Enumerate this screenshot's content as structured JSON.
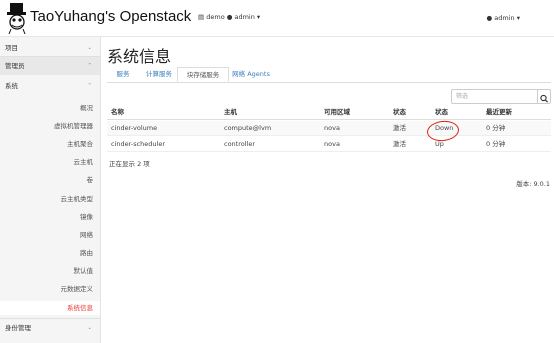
{
  "header": {
    "brand": "TaoYuhang's Openstack",
    "project_label": "demo ● admin ▾",
    "user_label": "admin ▾"
  },
  "sidebar": {
    "sections": [
      {
        "label": "项目",
        "chevron": "⌄"
      },
      {
        "label": "管理员",
        "chevron": "⌃"
      },
      {
        "label": "系统",
        "chevron": "⌃"
      }
    ],
    "items": [
      {
        "label": "概况"
      },
      {
        "label": "虚拟机管理器"
      },
      {
        "label": "主机聚合"
      },
      {
        "label": "云主机"
      },
      {
        "label": "卷"
      },
      {
        "label": "云主机类型"
      },
      {
        "label": "镜像"
      },
      {
        "label": "网络"
      },
      {
        "label": "路由"
      },
      {
        "label": "默认值"
      },
      {
        "label": "元数据定义"
      },
      {
        "label": "系统信息",
        "active": true
      }
    ],
    "identity": {
      "label": "身份管理",
      "chevron": "⌄"
    }
  },
  "main": {
    "title": "系统信息",
    "tabs": [
      {
        "label": "服务"
      },
      {
        "label": "计算服务"
      },
      {
        "label": "块存储服务",
        "active": true
      },
      {
        "label": "网络 Agents"
      }
    ],
    "search": {
      "placeholder": "筛选"
    },
    "table": {
      "columns": [
        "名称",
        "主机",
        "可用区域",
        "状态",
        "状态",
        "最近更新"
      ],
      "rows": [
        [
          "cinder-volume",
          "compute@lvm",
          "nova",
          "激活",
          "Down",
          "0 分钟"
        ],
        [
          "cinder-scheduler",
          "controller",
          "nova",
          "激活",
          "Up",
          "0 分钟"
        ]
      ]
    },
    "footer": "正在显示 2 项",
    "version": "版本: 9.0.1"
  },
  "colors": {
    "accent": "#3b7ebf",
    "active_nav": "#e33",
    "annotation": "#d21"
  }
}
